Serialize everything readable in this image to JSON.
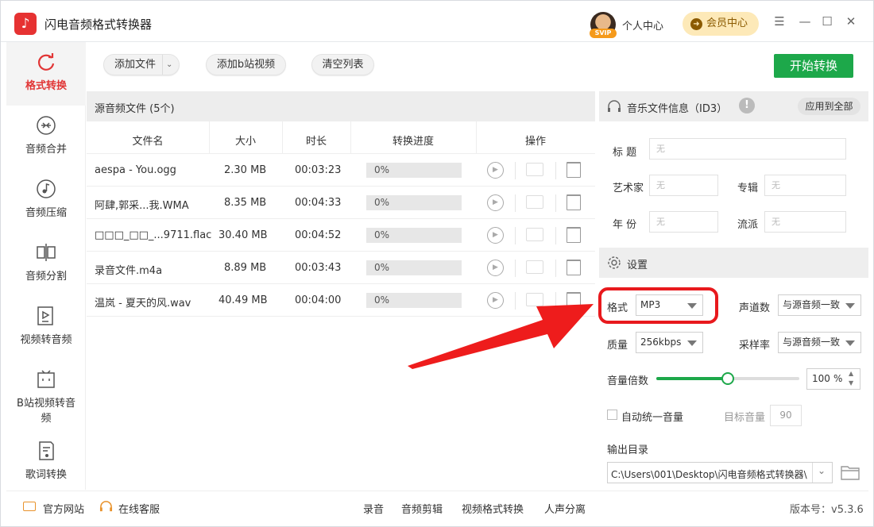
{
  "app": {
    "title": "闪电音频格式转换器"
  },
  "header": {
    "svip_badge": "SVIP",
    "personal_center": "个人中心",
    "vip_center": "会员中心"
  },
  "sidebar": {
    "items": [
      {
        "label": "格式转换",
        "icon": "format-convert-icon",
        "active": true
      },
      {
        "label": "音频合并",
        "icon": "merge-icon"
      },
      {
        "label": "音频压缩",
        "icon": "compress-icon"
      },
      {
        "label": "音频分割",
        "icon": "split-icon"
      },
      {
        "label": "视频转音频",
        "icon": "video-to-audio-icon"
      },
      {
        "label": "B站视频转音频",
        "icon": "bilibili-icon"
      },
      {
        "label": "歌词转换",
        "icon": "lyrics-icon"
      }
    ]
  },
  "toolbar": {
    "add_file": "添加文件",
    "add_bilibili": "添加b站视频",
    "clear_list": "清空列表",
    "start": "开始转换"
  },
  "file_table": {
    "title": "源音频文件 (5个)",
    "columns": [
      "文件名",
      "大小",
      "时长",
      "转换进度",
      "操作"
    ],
    "rows": [
      {
        "name": "aespa - You.ogg",
        "size": "2.30 MB",
        "duration": "00:03:23",
        "progress": "0%"
      },
      {
        "name": "阿肆,郭采...我.WMA",
        "size": "8.35 MB",
        "duration": "00:04:33",
        "progress": "0%"
      },
      {
        "name": "□□□_□□_...9711.flac",
        "size": "30.40 MB",
        "duration": "00:04:52",
        "progress": "0%"
      },
      {
        "name": "录音文件.m4a",
        "size": "8.89 MB",
        "duration": "00:03:43",
        "progress": "0%"
      },
      {
        "name": "温岚 - 夏天的风.wav",
        "size": "40.49 MB",
        "duration": "00:04:00",
        "progress": "0%"
      }
    ]
  },
  "id3": {
    "title": "音乐文件信息（ID3）",
    "apply_all": "应用到全部",
    "labels": {
      "title": "标  题",
      "artist": "艺术家",
      "album": "专辑",
      "year": "年  份",
      "genre": "流派"
    },
    "placeholder": "无"
  },
  "settings": {
    "title": "设置",
    "format_label": "格式",
    "format_value": "MP3",
    "channels_label": "声道数",
    "channels_value": "与源音频一致",
    "quality_label": "质量",
    "quality_value": "256kbps",
    "sample_rate_label": "采样率",
    "sample_rate_value": "与源音频一致",
    "volume_label": "音量倍数",
    "volume_value": "100",
    "volume_unit": "%",
    "volume_fraction": 0.5,
    "auto_volume_label": "自动统一音量",
    "target_volume_label": "目标音量",
    "target_volume_value": "90",
    "output_dir_label": "输出目录",
    "output_dir_value": "C:\\Users\\001\\Desktop\\闪电音频格式转换器\\"
  },
  "footer": {
    "website": "官方网站",
    "support": "在线客服",
    "links": [
      "录音",
      "音频剪辑",
      "视频格式转换",
      "人声分离"
    ],
    "version": "版本号：v5.3.6"
  },
  "colors": {
    "accent": "#e13535",
    "start_button": "#1da84a",
    "highlight": "#e8191d"
  }
}
